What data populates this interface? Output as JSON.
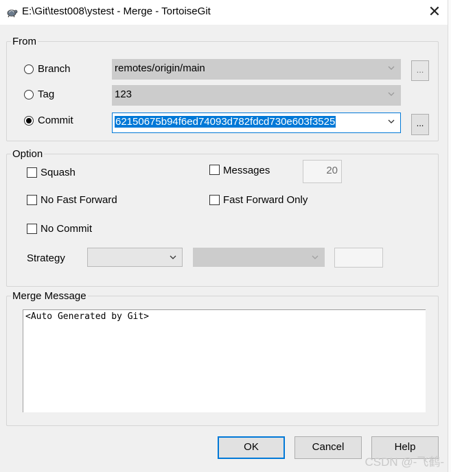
{
  "window": {
    "title": "E:\\Git\\test008\\ystest - Merge - TortoiseGit",
    "close_glyph": "✕",
    "app_icon": "tortoise-icon"
  },
  "from": {
    "label": "From",
    "branch": {
      "label": "Branch",
      "value": "remotes/origin/main",
      "checked": false
    },
    "tag": {
      "label": "Tag",
      "value": "123",
      "checked": false
    },
    "commit": {
      "label": "Commit",
      "value": "62150675b94f6ed74093d782fdcd730e603f3525",
      "checked": true
    },
    "browse_label": "..."
  },
  "option": {
    "label": "Option",
    "squash": "Squash",
    "messages": "Messages",
    "messages_count": "20",
    "no_fast_forward": "No Fast Forward",
    "fast_forward_only": "Fast Forward Only",
    "no_commit": "No Commit",
    "strategy": "Strategy"
  },
  "merge_message": {
    "label": "Merge Message",
    "text": "<Auto Generated by Git>"
  },
  "buttons": {
    "ok": "OK",
    "cancel": "Cancel",
    "help": "Help"
  },
  "watermark": "CSDN @-飞鹤-",
  "colors": {
    "accent": "#0078d7",
    "dialog_bg": "#f0f0f0",
    "disabled_combo": "#cccccc"
  }
}
